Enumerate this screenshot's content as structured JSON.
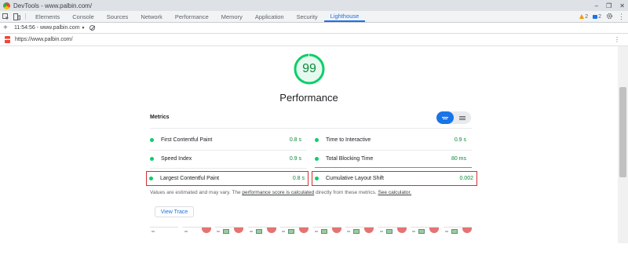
{
  "window": {
    "title": "DevTools - www.palbin.com/",
    "controls": [
      "–",
      "❐",
      "✕"
    ]
  },
  "tabs": [
    {
      "label": "Elements"
    },
    {
      "label": "Console"
    },
    {
      "label": "Sources"
    },
    {
      "label": "Network"
    },
    {
      "label": "Performance"
    },
    {
      "label": "Memory"
    },
    {
      "label": "Application"
    },
    {
      "label": "Security"
    },
    {
      "label": "Lighthouse",
      "active": true
    }
  ],
  "badges": {
    "warnings": "2",
    "messages": "2"
  },
  "report_bar": {
    "plus": "+",
    "report_select": "11:54:56 - www.palbin.com",
    "caret": "▼"
  },
  "url_bar": {
    "url": "https://www.palbin.com/",
    "menu": "⋮"
  },
  "report": {
    "score": "99",
    "score_fraction": 0.99,
    "category": "Performance",
    "metrics_heading": "Metrics",
    "metrics": [
      {
        "name": "First Contentful Paint",
        "value": "0.8 s"
      },
      {
        "name": "Time to Interactive",
        "value": "0.9 s"
      },
      {
        "name": "Speed Index",
        "value": "0.9 s"
      },
      {
        "name": "Total Blocking Time",
        "value": "80 ms"
      },
      {
        "name": "Largest Contentful Paint",
        "value": "0.8 s"
      },
      {
        "name": "Cumulative Layout Shift",
        "value": "0.002"
      }
    ],
    "note": {
      "prefix": "Values are estimated and may vary. The ",
      "link1": "performance score is calculated",
      "middle": " directly from these metrics. ",
      "link2": "See calculator."
    },
    "view_trace": "View Trace"
  },
  "colors": {
    "pass": "#0cce6b",
    "accent": "#1a73e8",
    "highlight": "#d32f2f"
  },
  "icons": [
    "inspect-icon",
    "device-toolbar-icon",
    "settings-icon",
    "more-icon",
    "clear-icon",
    "lighthouse-logo-icon"
  ]
}
